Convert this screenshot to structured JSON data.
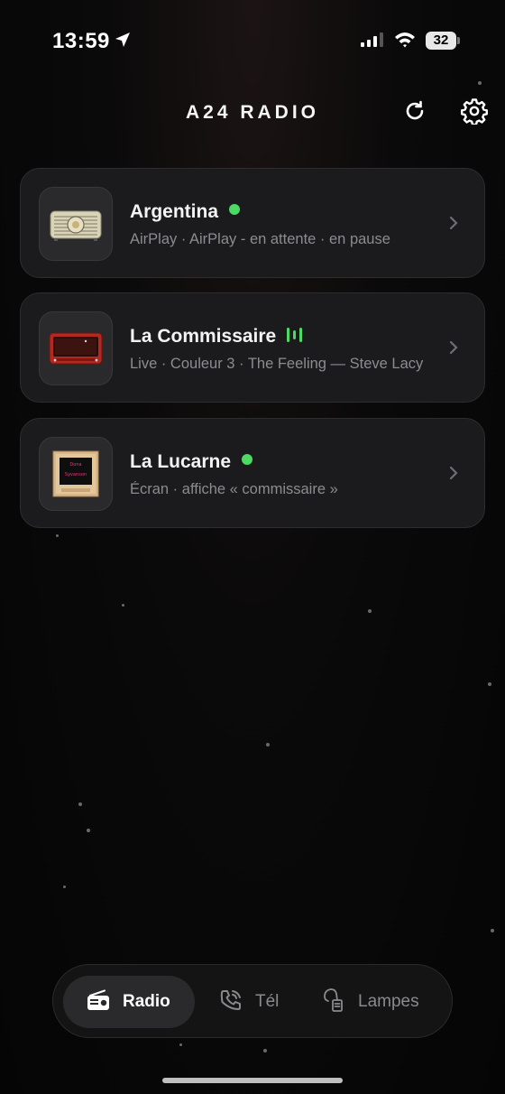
{
  "status_bar": {
    "time": "13:59",
    "battery": "32",
    "icons": [
      "location-arrow-icon",
      "cellular-signal-icon",
      "wifi-icon",
      "battery-icon"
    ]
  },
  "header": {
    "title": "A24 RADIO",
    "refresh_icon": "refresh-icon",
    "settings_icon": "gear-icon"
  },
  "devices": [
    {
      "name": "Argentina",
      "status_indicator": "green-dot",
      "subtitle": "AirPlay · AirPlay - en attente · en pause",
      "thumbnail": "vintage-cream-radio"
    },
    {
      "name": "La Commissaire",
      "status_indicator": "equalizer-bars",
      "subtitle": "Live · Couleur 3 · The Feeling — Steve Lacy",
      "thumbnail": "vintage-red-radio"
    },
    {
      "name": "La Lucarne",
      "status_indicator": "green-dot",
      "subtitle": "Écran · affiche « commissaire »",
      "thumbnail": "wooden-screen-frame",
      "thumbnail_text": [
        "Dona",
        "Syvanson"
      ]
    }
  ],
  "tabs": [
    {
      "label": "Radio",
      "icon": "radio-icon",
      "active": true
    },
    {
      "label": "Tél",
      "icon": "phone-icon",
      "active": false
    },
    {
      "label": "Lampes",
      "icon": "lamp-icon",
      "active": false
    }
  ],
  "colors": {
    "accent_green": "#4cd964",
    "card_bg": "#1b1b1d",
    "background": "#050505"
  }
}
